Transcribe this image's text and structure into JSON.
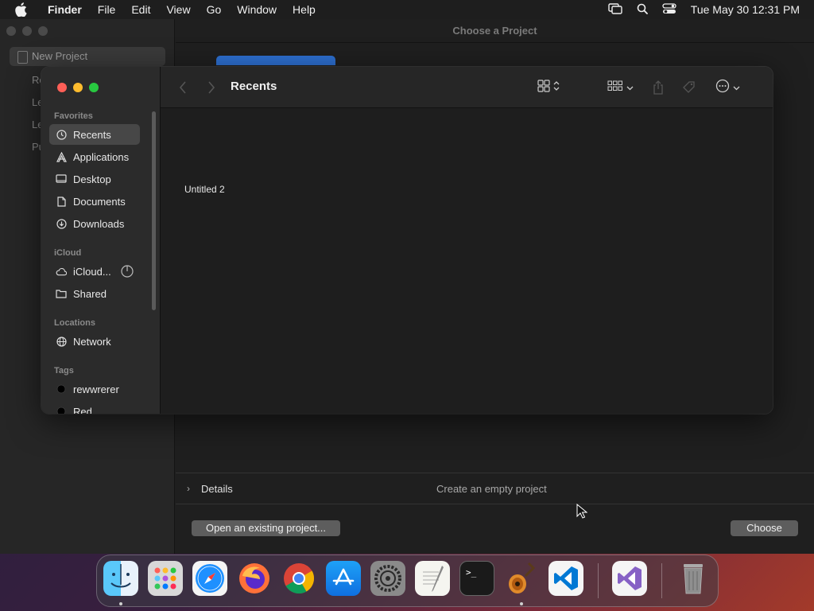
{
  "menubar": {
    "app_name": "Finder",
    "items": [
      "File",
      "Edit",
      "View",
      "Go",
      "Window",
      "Help"
    ],
    "clock": "Tue May 30  12:31 PM"
  },
  "background_app": {
    "title": "Choose a Project",
    "new_project_label": "New Project",
    "sidebar_clipped": [
      "Re",
      "Le",
      "Le",
      "Pu"
    ],
    "details_label": "Details",
    "details_description": "Create an empty project",
    "open_existing_label": "Open an existing project...",
    "choose_label": "Choose"
  },
  "finder": {
    "title": "Recents",
    "sections": {
      "favorites": "Favorites",
      "icloud": "iCloud",
      "locations": "Locations",
      "tags": "Tags"
    },
    "favorites": [
      {
        "label": "Recents",
        "icon": "clock-icon"
      },
      {
        "label": "Applications",
        "icon": "applications-icon"
      },
      {
        "label": "Desktop",
        "icon": "desktop-icon"
      },
      {
        "label": "Documents",
        "icon": "document-icon"
      },
      {
        "label": "Downloads",
        "icon": "download-icon"
      }
    ],
    "icloud": [
      {
        "label": "iCloud...",
        "icon": "cloud-icon"
      },
      {
        "label": "Shared",
        "icon": "shared-folder-icon"
      }
    ],
    "locations": [
      {
        "label": "Network",
        "icon": "globe-icon"
      }
    ],
    "tags": [
      {
        "label": "rewwrerer",
        "color": "#000000"
      },
      {
        "label": "Red",
        "color": "#000000"
      }
    ],
    "files": [
      {
        "name": "Untitled 2"
      }
    ]
  },
  "dock": {
    "apps": [
      "finder",
      "launchpad",
      "safari",
      "firefox",
      "chrome",
      "app-store",
      "system-settings",
      "textedit",
      "terminal",
      "garageband",
      "vscode",
      "visual-studio",
      "trash"
    ]
  },
  "colors": {
    "close": "#ff5f57",
    "minimize": "#febc2e",
    "zoom": "#28c840",
    "accent": "#2d6fd0"
  }
}
